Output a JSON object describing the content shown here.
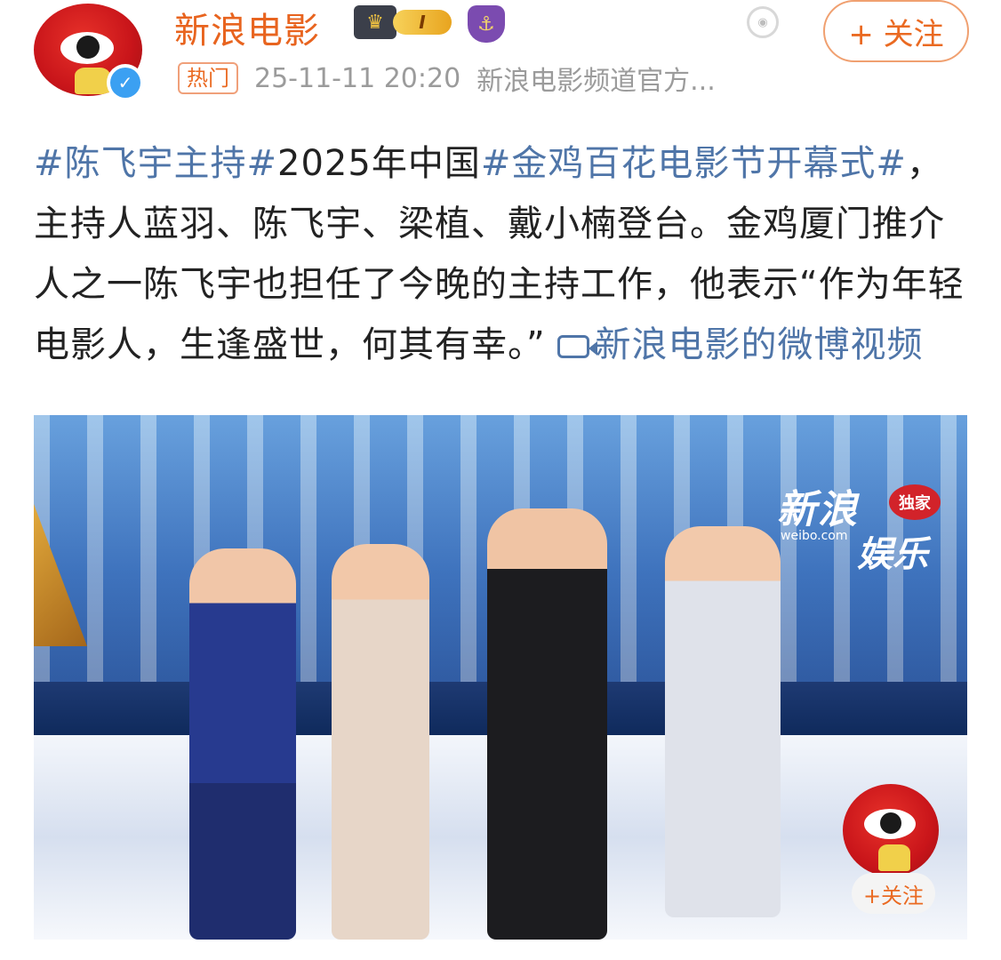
{
  "header": {
    "name": "新浪电影",
    "level_badge": "I",
    "follow_label": "+ 关注",
    "hot_tag": "热门",
    "timestamp": "25-11-11 20:20",
    "source": "新浪电影频道官方..."
  },
  "post": {
    "tag1": "#陈飞宇主持#",
    "text1": "2025年中国",
    "tag2": "#金鸡百花电影节开幕式#",
    "text2": "，主持人蓝羽、陈飞宇、梁植、戴小楠登台。金鸡厦门推介人之一陈飞宇也担任了今晚的主持工作，他表示“作为年轻电影人，生逢盛世，何其有幸。”",
    "video_link": "新浪电影的微博视频"
  },
  "media": {
    "logo_line1": "新浪",
    "logo_exclusive": "独家",
    "logo_domain": "weibo.com",
    "logo_line2": "娱乐",
    "float_follow": "+关注"
  },
  "colors": {
    "brand_orange": "#ea6a22",
    "link_blue": "#4f75a8",
    "verified_blue": "#3ba0f2"
  }
}
